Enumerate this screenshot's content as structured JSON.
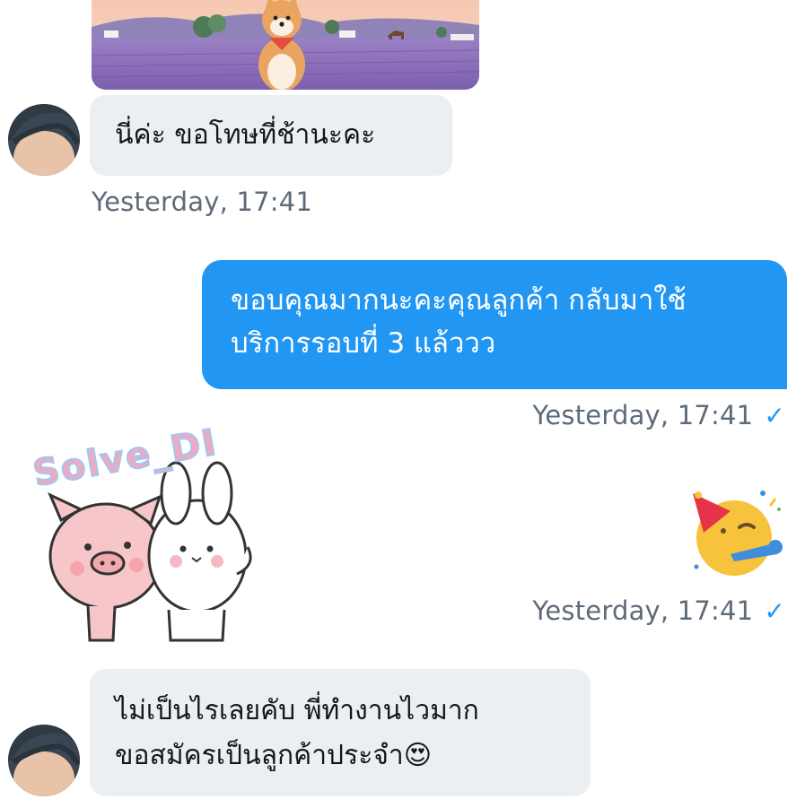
{
  "messages": [
    {
      "id": "m1",
      "direction": "incoming",
      "type": "image",
      "icon": "lavender-field-shiba-photo"
    },
    {
      "id": "m2",
      "direction": "incoming",
      "type": "text",
      "text": "นี่ค่ะ ขอโทษที่ช้านะคะ",
      "time": "Yesterday, 17:41"
    },
    {
      "id": "m3",
      "direction": "outgoing",
      "type": "text",
      "lines": [
        "ขอบคุณมากนะคะคุณลูกค้า กลับมาใช้",
        "บริการรอบที่ 3 แล้ววว"
      ],
      "time": "Yesterday, 17:41",
      "status_icon": "read-check-icon"
    },
    {
      "id": "m4",
      "direction": "outgoing",
      "type": "emoji",
      "icon": "partying-face-emoji",
      "time": "Yesterday, 17:41",
      "status_icon": "read-check-icon"
    },
    {
      "id": "m5",
      "direction": "incoming",
      "type": "sticker",
      "sticker_text": "Solve_DI",
      "icon": "pig-and-bunny-sticker"
    },
    {
      "id": "m6",
      "direction": "incoming",
      "type": "text",
      "lines": [
        "ไม่เป็นไรเลยคับ พี่ทำงานไวมาก",
        "ขอสมัครเป็นลูกค้าประจำ"
      ],
      "trailing_emoji": "😍",
      "trailing_emoji_icon": "heart-eyes-emoji"
    }
  ],
  "colors": {
    "outgoing_bubble": "#2196f3",
    "incoming_bubble": "#eceff2",
    "timestamp": "#5d6a78",
    "check": "#2196f3"
  }
}
